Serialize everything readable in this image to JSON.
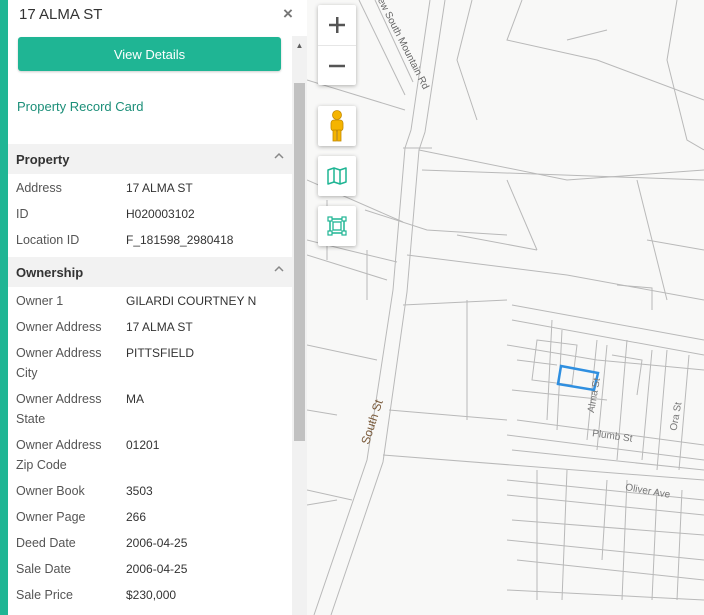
{
  "panel": {
    "title": "17 ALMA ST",
    "close_label": "×",
    "view_details_label": "View Details",
    "property_record_link": "Property Record Card"
  },
  "sections": {
    "property": {
      "title": "Property",
      "rows": [
        {
          "label": "Address",
          "value": "17 ALMA ST"
        },
        {
          "label": "ID",
          "value": "H020003102"
        },
        {
          "label": "Location ID",
          "value": "F_181598_2980418"
        }
      ]
    },
    "ownership": {
      "title": "Ownership",
      "rows": [
        {
          "label": "Owner 1",
          "value": "GILARDI COURTNEY N"
        },
        {
          "label": "Owner Address",
          "value": "17 ALMA ST"
        },
        {
          "label": "Owner Address City",
          "value": "PITTSFIELD"
        },
        {
          "label": "Owner Address State",
          "value": "MA"
        },
        {
          "label": "Owner Address Zip Code",
          "value": "01201"
        },
        {
          "label": "Owner Book",
          "value": "3503"
        },
        {
          "label": "Owner Page",
          "value": "266"
        },
        {
          "label": "Deed Date",
          "value": "2006-04-25"
        },
        {
          "label": "Sale Date",
          "value": "2006-04-25"
        },
        {
          "label": "Sale Price",
          "value": "$230,000"
        }
      ]
    }
  },
  "map": {
    "zoom_in_label": "+",
    "zoom_out_label": "−",
    "tools": [
      "street-view-icon",
      "basemap-icon",
      "extent-icon"
    ],
    "road_labels": {
      "new_south_mountain": "New South Mountain Rd",
      "south_st": "South St",
      "alma_st": "Alma St",
      "plumb_st": "Plumb St",
      "ora_st": "Ora St",
      "oliver_ave": "Oliver Ave"
    }
  },
  "colors": {
    "accent": "#1fb594",
    "link": "#1c8f79",
    "selected_parcel": "#2f8fe0",
    "road_label": "#7a5a3a"
  }
}
